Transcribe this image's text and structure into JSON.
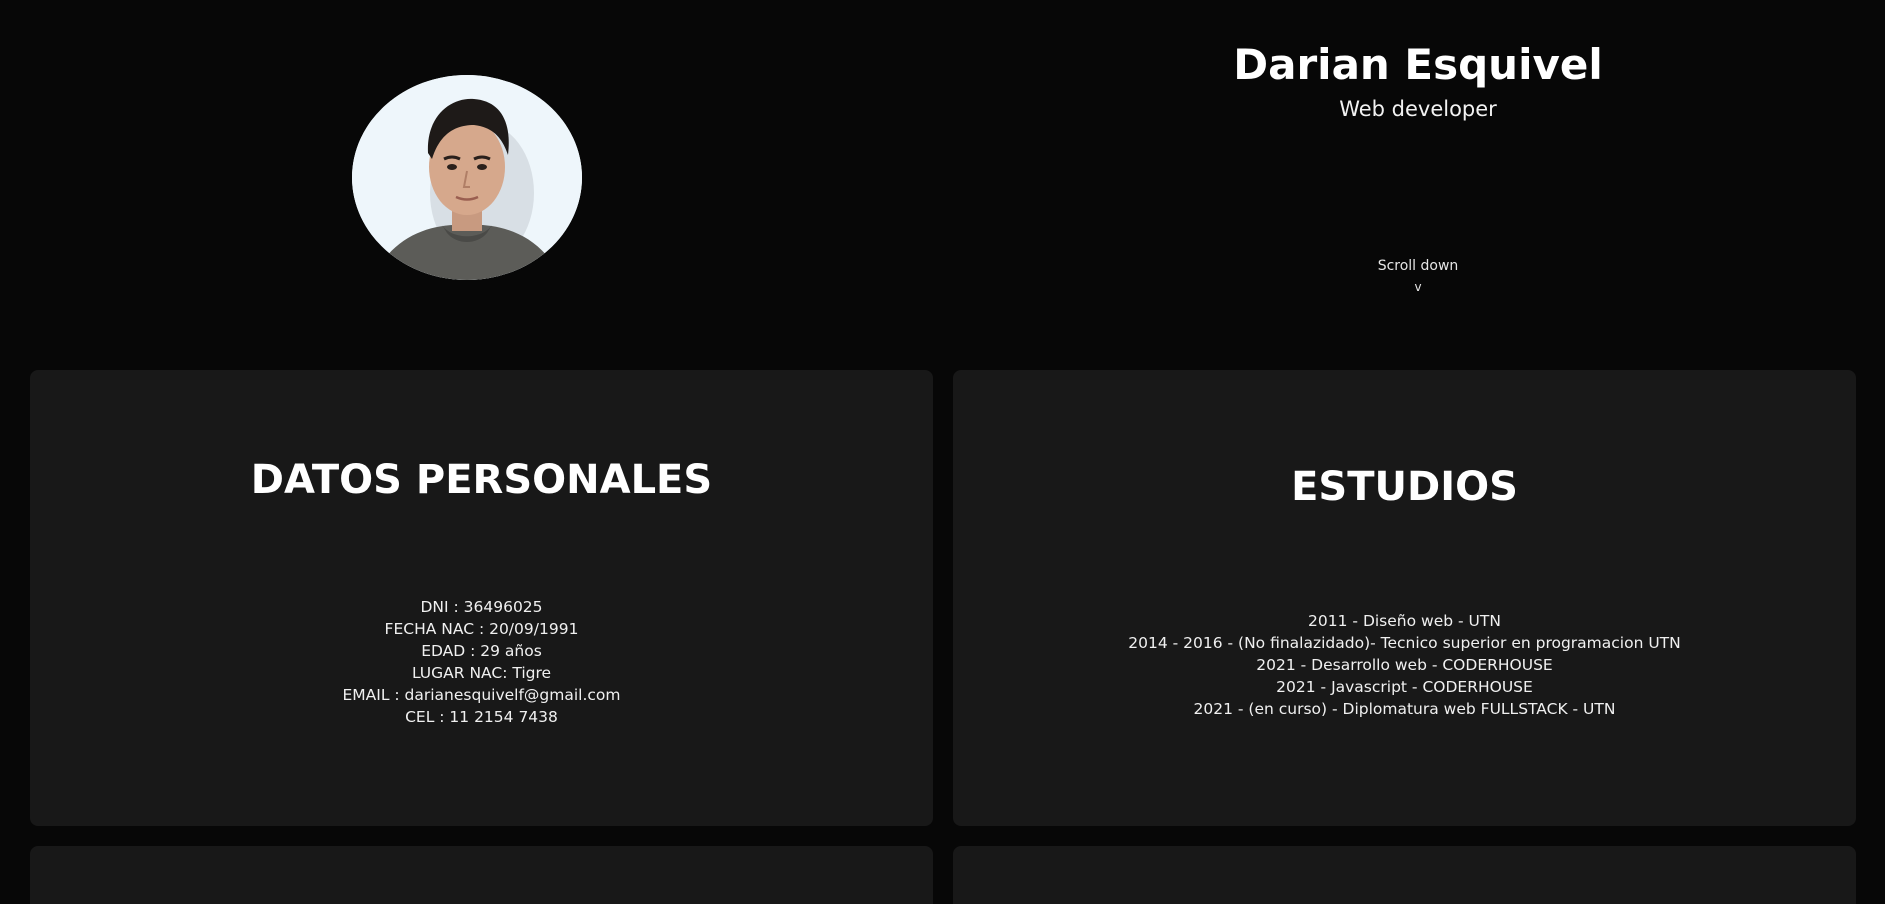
{
  "hero": {
    "name": "Darian Esquivel",
    "role": "Web developer",
    "scroll_label": "Scroll down",
    "scroll_arrow": "v"
  },
  "personal": {
    "title": "DATOS PERSONALES",
    "lines": [
      "DNI : 36496025",
      "FECHA NAC : 20/09/1991",
      "EDAD : 29 años",
      "LUGAR NAC: Tigre",
      "EMAIL : darianesquivelf@gmail.com",
      "CEL : 11 2154 7438"
    ]
  },
  "studies": {
    "title": "ESTUDIOS",
    "lines": [
      "2011 - Diseño web - UTN",
      "2014 - 2016 - (No finalazidado)- Tecnico superior en programacion UTN",
      "2021 - Desarrollo web - CODERHOUSE",
      "2021 - Javascript - CODERHOUSE",
      "2021 - (en curso) - Diplomatura web FULLSTACK - UTN"
    ]
  },
  "colors": {
    "background": "#070707",
    "card": "#181818",
    "text": "#ffffff"
  }
}
